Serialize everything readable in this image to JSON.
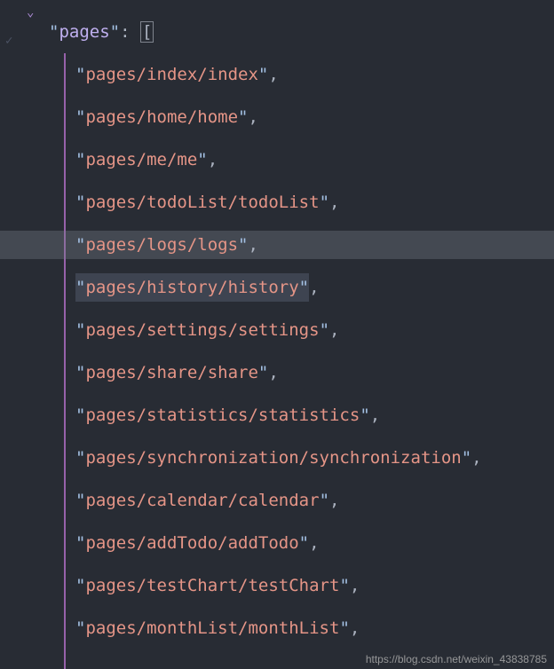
{
  "key_name": "pages",
  "bracket_open": "[",
  "entries": [
    {
      "value": "pages/index/index",
      "highlighted": false,
      "selected": false
    },
    {
      "value": "pages/home/home",
      "highlighted": false,
      "selected": false
    },
    {
      "value": "pages/me/me",
      "highlighted": false,
      "selected": false
    },
    {
      "value": "pages/todoList/todoList",
      "highlighted": false,
      "selected": false
    },
    {
      "value": "pages/logs/logs",
      "highlighted": true,
      "selected": false
    },
    {
      "value": "pages/history/history",
      "highlighted": false,
      "selected": true
    },
    {
      "value": "pages/settings/settings",
      "highlighted": false,
      "selected": false
    },
    {
      "value": "pages/share/share",
      "highlighted": false,
      "selected": false
    },
    {
      "value": "pages/statistics/statistics",
      "highlighted": false,
      "selected": false
    },
    {
      "value": "pages/synchronization/synchronization",
      "highlighted": false,
      "selected": false
    },
    {
      "value": "pages/calendar/calendar",
      "highlighted": false,
      "selected": false
    },
    {
      "value": "pages/addTodo/addTodo",
      "highlighted": false,
      "selected": false
    },
    {
      "value": "pages/testChart/testChart",
      "highlighted": false,
      "selected": false
    },
    {
      "value": "pages/monthList/monthList",
      "highlighted": false,
      "selected": false
    }
  ],
  "gutter": {
    "checkmark": "✓"
  },
  "watermark": "https://blog.csdn.net/weixin_43838785"
}
